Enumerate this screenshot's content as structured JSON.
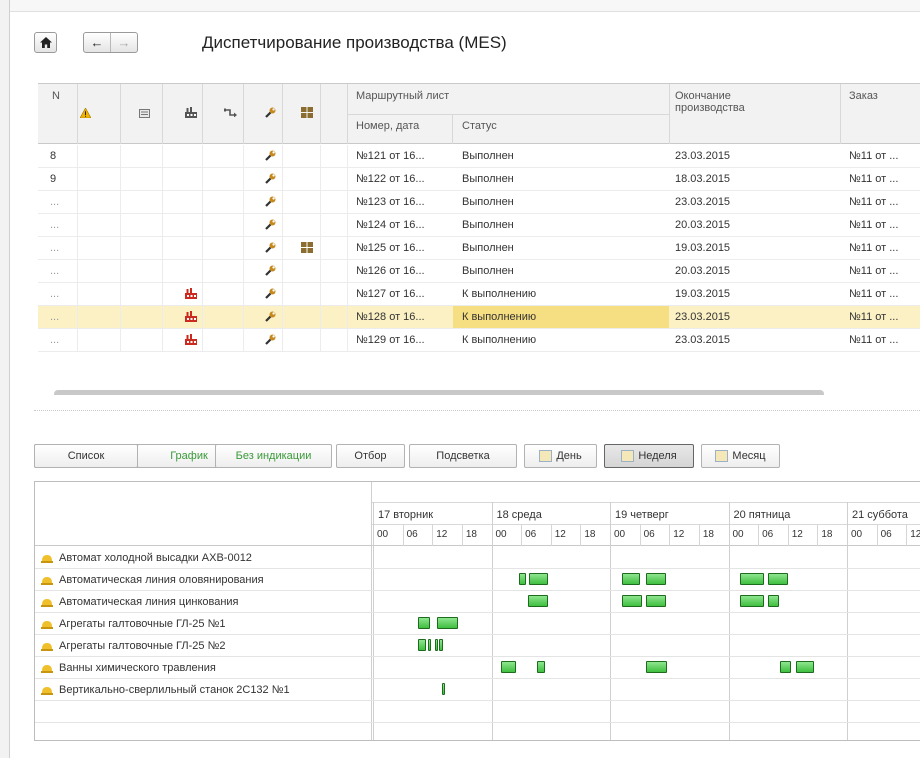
{
  "header": {
    "title": "Диспетчирование производства (MES)",
    "home_icon": "home-icon",
    "back_icon": "←",
    "forward_icon": "→"
  },
  "table": {
    "columns": {
      "n": "N",
      "route_sheet": "Маршрутный лист",
      "number_date": "Номер, дата",
      "status": "Статус",
      "end_production": "Окончание производства",
      "order": "Заказ"
    },
    "header_icons": [
      "warning-icon",
      "document-icon",
      "factory-icon",
      "route-icon",
      "wrench-icon",
      "boxes-icon"
    ],
    "rows": [
      {
        "n": "8",
        "factory": false,
        "boxes": false,
        "number": "№121 от 16...",
        "status": "Выполнен",
        "end": "23.03.2015",
        "order": "№11 от ..."
      },
      {
        "n": "9",
        "factory": false,
        "boxes": false,
        "number": "№122 от 16...",
        "status": "Выполнен",
        "end": "18.03.2015",
        "order": "№11 от ..."
      },
      {
        "n": "...",
        "factory": false,
        "boxes": false,
        "number": "№123 от 16...",
        "status": "Выполнен",
        "end": "23.03.2015",
        "order": "№11 от ..."
      },
      {
        "n": "...",
        "factory": false,
        "boxes": false,
        "number": "№124 от 16...",
        "status": "Выполнен",
        "end": "20.03.2015",
        "order": "№11 от ..."
      },
      {
        "n": "...",
        "factory": false,
        "boxes": true,
        "number": "№125 от 16...",
        "status": "Выполнен",
        "end": "19.03.2015",
        "order": "№11 от ..."
      },
      {
        "n": "...",
        "factory": false,
        "boxes": false,
        "number": "№126 от 16...",
        "status": "Выполнен",
        "end": "20.03.2015",
        "order": "№11 от ..."
      },
      {
        "n": "...",
        "factory": true,
        "boxes": false,
        "number": "№127 от 16...",
        "status": "К выполнению",
        "end": "19.03.2015",
        "order": "№11 от ..."
      },
      {
        "n": "...",
        "factory": true,
        "boxes": false,
        "number": "№128 от 16...",
        "status": "К выполнению",
        "end": "23.03.2015",
        "order": "№11 от ...",
        "selected": true
      },
      {
        "n": "...",
        "factory": true,
        "boxes": false,
        "number": "№129 от 16...",
        "status": "К выполнению",
        "end": "23.03.2015",
        "order": "№11 от ..."
      }
    ]
  },
  "toolbar": {
    "list": "Список",
    "schedule": "График",
    "no_indication": "Без индикации",
    "filter": "Отбор",
    "highlight": "Подсветка",
    "day": "День",
    "week": "Неделя",
    "month": "Месяц",
    "active_view": "week"
  },
  "gantt": {
    "days": [
      "17 вторник",
      "18 среда",
      "19 четверг",
      "20 пятница",
      "21 суббота"
    ],
    "hours": [
      "00",
      "06",
      "12",
      "18"
    ],
    "resources": [
      {
        "name": "Автомат холодной высадки АХВ-0012",
        "tasks": []
      },
      {
        "name": "Автоматическая линия оловянирования",
        "tasks": [
          [
            1.23,
            1.29
          ],
          [
            1.32,
            1.48
          ],
          [
            2.1,
            2.25
          ],
          [
            2.3,
            2.47
          ],
          [
            3.1,
            3.3
          ],
          [
            3.33,
            3.5
          ]
        ]
      },
      {
        "name": "Автоматическая линия цинкования",
        "tasks": [
          [
            1.31,
            1.48
          ],
          [
            2.1,
            2.27
          ],
          [
            2.3,
            2.47
          ],
          [
            3.1,
            3.3
          ],
          [
            3.33,
            3.43
          ]
        ]
      },
      {
        "name": "Агрегаты галтовочные ГЛ-25 №1",
        "tasks": [
          [
            0.38,
            0.48
          ],
          [
            0.54,
            0.72
          ]
        ]
      },
      {
        "name": "Агрегаты галтовочные ГЛ-25 №2",
        "tasks": [
          [
            0.38,
            0.45
          ],
          [
            0.46,
            0.49
          ],
          [
            0.52,
            0.55
          ],
          [
            0.56,
            0.59
          ]
        ]
      },
      {
        "name": "Ванны химического травления",
        "tasks": [
          [
            1.08,
            1.21
          ],
          [
            1.38,
            1.45
          ],
          [
            2.3,
            2.48
          ],
          [
            3.43,
            3.53
          ],
          [
            3.57,
            3.72
          ]
        ]
      },
      {
        "name": "Вертикально-сверлильный станок 2С132 №1",
        "tasks": [
          [
            0.58,
            0.6
          ]
        ]
      }
    ]
  },
  "colors": {
    "selected_row": "#fbf1c4",
    "bar_green": "#3fbf3f",
    "factory_red": "#cc2a1e",
    "resource_hat": "#f0c02c"
  }
}
